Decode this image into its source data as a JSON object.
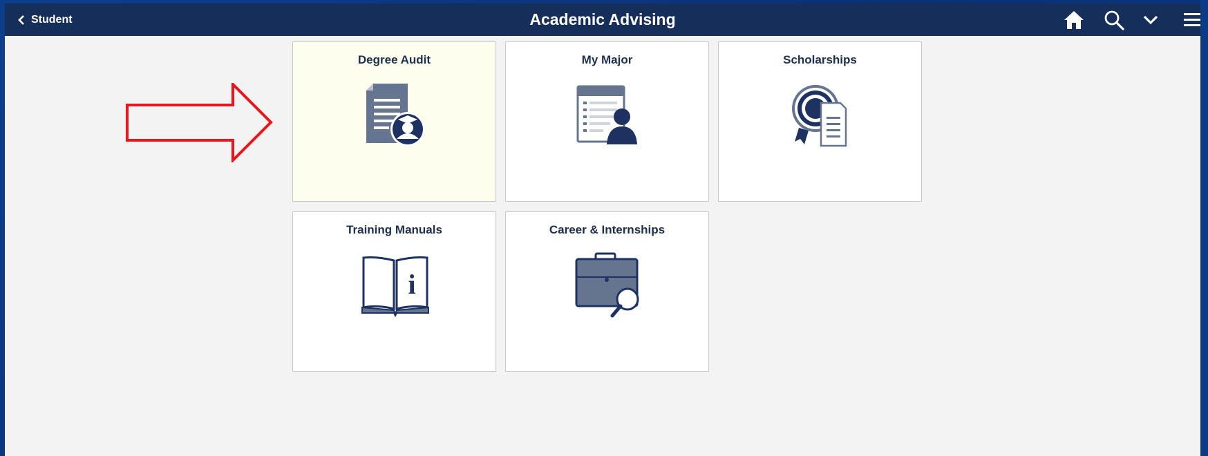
{
  "header": {
    "back_label": "Student",
    "title": "Academic Advising",
    "icons": [
      "home-icon",
      "search-icon",
      "chevron-down-icon",
      "menu-icon"
    ]
  },
  "tiles": [
    {
      "label": "Degree Audit",
      "icon": "degree-audit-icon",
      "highlighted": true
    },
    {
      "label": "My Major",
      "icon": "my-major-icon"
    },
    {
      "label": "Scholarships",
      "icon": "scholarship-icon"
    },
    {
      "label": "Training Manuals",
      "icon": "training-manual-icon"
    },
    {
      "label": "Career & Internships",
      "icon": "career-briefcase-icon"
    }
  ],
  "annotation": {
    "icon": "red-arrow-icon",
    "color": "#e8161b"
  },
  "colors": {
    "header_bg": "#162f5a",
    "icon_fill": "#66758f",
    "icon_dark": "#1d3260",
    "highlight_tile": "#fefeee"
  }
}
